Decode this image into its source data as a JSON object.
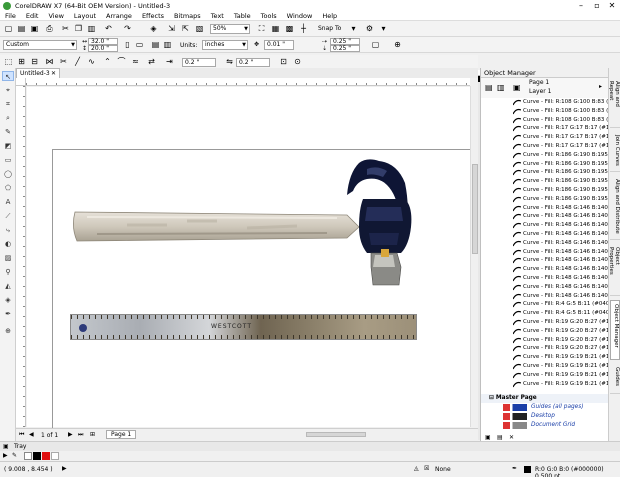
{
  "window": {
    "title": "CorelDRAW X7 (64-Bit OEM Version) - Untitled-3"
  },
  "menu": [
    "File",
    "Edit",
    "View",
    "Layout",
    "Arrange",
    "Effects",
    "Bitmaps",
    "Text",
    "Table",
    "Tools",
    "Window",
    "Help"
  ],
  "toolbar": {
    "zoom": "50%",
    "snap_to": "Snap To"
  },
  "propbar": {
    "preset": "Custom",
    "width": "32.0 \"",
    "height": "20.0 \"",
    "units_label": "Units:",
    "units": "inches",
    "nudge": "0.01 \"",
    "dup_x": "0.25 \"",
    "dup_y": "0.25 \"",
    "field_a": "0.2 \"",
    "field_b": "0.2 \""
  },
  "document": {
    "tab": "Untitled-3",
    "page_count": "1 of 1",
    "page_tab": "Page 1"
  },
  "colors": {
    "accent": "#1a3fa8",
    "selection": "#cfe3ff",
    "hammer_head": "#0e1535",
    "handle": "#d6cfc3"
  },
  "object_manager": {
    "title": "Object Manager",
    "page": "Page 1",
    "layer": "Layer 1",
    "items": [
      "Curve - Fill: R:108 G:100 B:83 (#",
      "Curve - Fill: R:108 G:100 B:83 (#",
      "Curve - Fill: R:108 G:100 B:83 (#",
      "Curve - Fill: R:17 G:17 B:17 (#1",
      "Curve - Fill: R:17 G:17 B:17 (#1",
      "Curve - Fill: R:17 G:17 B:17 (#1",
      "Curve - Fill: R:186 G:190 B:195",
      "Curve - Fill: R:186 G:190 B:195",
      "Curve - Fill: R:186 G:190 B:195",
      "Curve - Fill: R:186 G:190 B:195",
      "Curve - Fill: R:186 G:190 B:195",
      "Curve - Fill: R:186 G:190 B:195",
      "Curve - Fill: R:148 G:146 B:140",
      "Curve - Fill: R:148 G:146 B:140",
      "Curve - Fill: R:148 G:146 B:140",
      "Curve - Fill: R:148 G:146 B:140",
      "Curve - Fill: R:148 G:146 B:140",
      "Curve - Fill: R:148 G:146 B:140",
      "Curve - Fill: R:148 G:146 B:140",
      "Curve - Fill: R:148 G:146 B:140",
      "Curve - Fill: R:148 G:146 B:140",
      "Curve - Fill: R:148 G:146 B:140",
      "Curve - Fill: R:148 G:146 B:140",
      "Curve - Fill: R:4 G:5 B:11 (#0405",
      "Curve - Fill: R:4 G:5 B:11 (#0405",
      "Curve - Fill: R:19 G:20 B:27 (#1",
      "Curve - Fill: R:19 G:20 B:27 (#1",
      "Curve - Fill: R:19 G:20 B:27 (#1",
      "Curve - Fill: R:19 G:20 B:27 (#1",
      "Curve - Fill: R:19 G:19 B:21 (#1",
      "Curve - Fill: R:19 G:19 B:21 (#1",
      "Curve - Fill: R:19 G:19 B:21 (#1",
      "Curve - Fill: R:19 G:19 B:21 (#1"
    ],
    "master_page": "Master Page",
    "master_layers": [
      "Guides (all pages)",
      "Desktop",
      "Document Grid"
    ]
  },
  "side_tabs": [
    "Align and Repeat",
    "Join Curves",
    "Align and Distribute",
    "Object Properties",
    "Object Manager",
    "Guides"
  ],
  "tray": {
    "label": "Tray"
  },
  "ruler_label": "WESTCOTT",
  "status": {
    "coords": "( 9.008 , 8.454 )",
    "fill": "None",
    "outline": "R:0 G:0 B:0 (#000000)  0.500 pt"
  }
}
